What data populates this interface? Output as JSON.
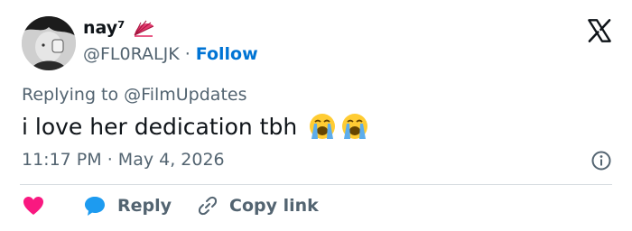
{
  "author": {
    "display_name": "nay⁷",
    "handle": "@FL0RALJK",
    "separator": "·",
    "follow_label": "Follow"
  },
  "tweet": {
    "reply_prefix": "Replying to ",
    "reply_to": "@FilmUpdates",
    "text": "i love her dedication tbh",
    "emojis": [
      "loudly-crying-face",
      "loudly-crying-face"
    ],
    "time": "11:17 PM",
    "date_separator": "·",
    "date": "May 4, 2026"
  },
  "actions": {
    "reply_label": "Reply",
    "copy_link_label": "Copy link"
  },
  "colors": {
    "follow_blue": "#0074d4",
    "heart": "#f91880",
    "reply_bubble": "#1d9bf0",
    "secondary_text": "#536471"
  }
}
